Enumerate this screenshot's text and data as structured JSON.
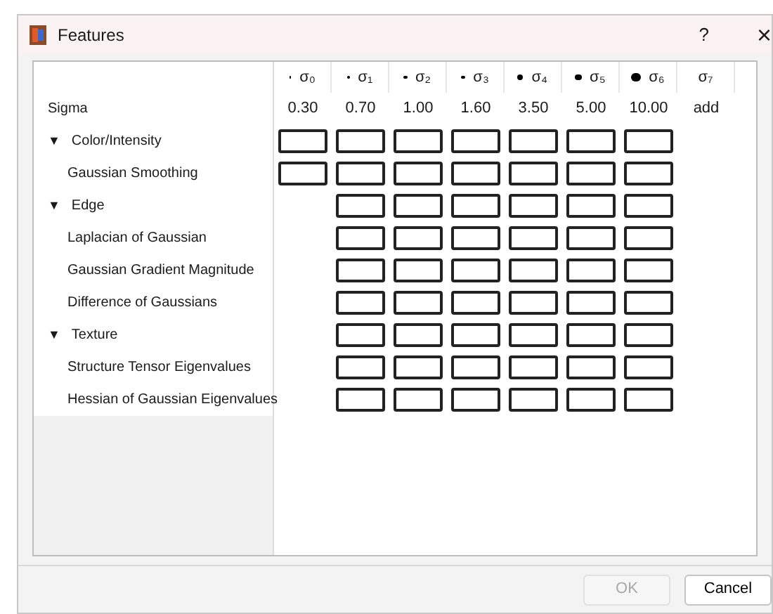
{
  "window": {
    "title": "Features",
    "help": "?",
    "close": "×"
  },
  "columns": [
    {
      "label": "σ₀",
      "marker": true
    },
    {
      "label": "σ₁",
      "marker": true
    },
    {
      "label": "σ₂",
      "marker": true
    },
    {
      "label": "σ₃",
      "marker": true
    },
    {
      "label": "σ₄",
      "marker": true
    },
    {
      "label": "σ₅",
      "marker": true
    },
    {
      "label": "σ₆",
      "marker": true
    },
    {
      "label": "σ₇",
      "marker": false
    }
  ],
  "sigma": {
    "label": "Sigma",
    "values": [
      "0.30",
      "0.70",
      "1.00",
      "1.60",
      "3.50",
      "5.00",
      "10.00",
      "add"
    ]
  },
  "groups": [
    {
      "label": "Color/Intensity",
      "expanded": true,
      "toggle": "▼",
      "cells": [
        {
          "kind": "checkbox",
          "checked": false
        },
        {
          "kind": "checkbox",
          "checked": false
        },
        {
          "kind": "checkbox",
          "checked": false
        },
        {
          "kind": "checkbox",
          "checked": false
        },
        {
          "kind": "checkbox",
          "checked": false
        },
        {
          "kind": "checkbox",
          "checked": false
        },
        {
          "kind": "checkbox",
          "checked": false
        }
      ],
      "children": [
        {
          "label": "Gaussian Smoothing",
          "cells": [
            {
              "kind": "checkbox",
              "checked": false
            },
            {
              "kind": "checkbox",
              "checked": false
            },
            {
              "kind": "checkbox",
              "checked": false
            },
            {
              "kind": "checkbox",
              "checked": false
            },
            {
              "kind": "checkbox",
              "checked": false
            },
            {
              "kind": "checkbox",
              "checked": false
            },
            {
              "kind": "checkbox",
              "checked": false
            }
          ]
        }
      ]
    },
    {
      "label": "Edge",
      "expanded": true,
      "toggle": "▼",
      "cells": [
        {
          "kind": "empty"
        },
        {
          "kind": "checkbox",
          "checked": false
        },
        {
          "kind": "checkbox",
          "checked": false
        },
        {
          "kind": "checkbox",
          "checked": false
        },
        {
          "kind": "checkbox",
          "checked": false
        },
        {
          "kind": "checkbox",
          "checked": false
        },
        {
          "kind": "checkbox",
          "checked": false
        }
      ],
      "children": [
        {
          "label": "Laplacian of Gaussian",
          "cells": [
            {
              "kind": "empty"
            },
            {
              "kind": "checkbox",
              "checked": false
            },
            {
              "kind": "checkbox",
              "checked": false
            },
            {
              "kind": "checkbox",
              "checked": false
            },
            {
              "kind": "checkbox",
              "checked": false
            },
            {
              "kind": "checkbox",
              "checked": false
            },
            {
              "kind": "checkbox",
              "checked": false
            }
          ]
        },
        {
          "label": "Gaussian Gradient Magnitude",
          "cells": [
            {
              "kind": "empty"
            },
            {
              "kind": "checkbox",
              "checked": false
            },
            {
              "kind": "checkbox",
              "checked": false
            },
            {
              "kind": "checkbox",
              "checked": false
            },
            {
              "kind": "checkbox",
              "checked": false
            },
            {
              "kind": "checkbox",
              "checked": false
            },
            {
              "kind": "checkbox",
              "checked": false
            }
          ]
        },
        {
          "label": "Difference of Gaussians",
          "cells": [
            {
              "kind": "empty"
            },
            {
              "kind": "checkbox",
              "checked": false
            },
            {
              "kind": "checkbox",
              "checked": false
            },
            {
              "kind": "checkbox",
              "checked": false
            },
            {
              "kind": "checkbox",
              "checked": false
            },
            {
              "kind": "checkbox",
              "checked": false
            },
            {
              "kind": "checkbox",
              "checked": false
            }
          ]
        }
      ]
    },
    {
      "label": "Texture",
      "expanded": true,
      "toggle": "▼",
      "cells": [
        {
          "kind": "empty"
        },
        {
          "kind": "checkbox",
          "checked": false
        },
        {
          "kind": "checkbox",
          "checked": false
        },
        {
          "kind": "checkbox",
          "checked": false
        },
        {
          "kind": "checkbox",
          "checked": false
        },
        {
          "kind": "checkbox",
          "checked": false
        },
        {
          "kind": "checkbox",
          "checked": false
        }
      ],
      "children": [
        {
          "label": "Structure Tensor Eigenvalues",
          "cells": [
            {
              "kind": "empty"
            },
            {
              "kind": "checkbox",
              "checked": false
            },
            {
              "kind": "checkbox",
              "checked": false
            },
            {
              "kind": "checkbox",
              "checked": false
            },
            {
              "kind": "checkbox",
              "checked": false
            },
            {
              "kind": "checkbox",
              "checked": false
            },
            {
              "kind": "checkbox",
              "checked": false
            }
          ]
        },
        {
          "label": "Hessian of Gaussian Eigenvalues",
          "cells": [
            {
              "kind": "empty"
            },
            {
              "kind": "checkbox",
              "checked": false
            },
            {
              "kind": "checkbox",
              "checked": false
            },
            {
              "kind": "checkbox",
              "checked": false
            },
            {
              "kind": "checkbox",
              "checked": false
            },
            {
              "kind": "checkbox",
              "checked": false
            },
            {
              "kind": "checkbox",
              "checked": false
            }
          ]
        }
      ]
    }
  ],
  "buttons": [
    {
      "label": "OK",
      "disabled": true
    },
    {
      "label": "Cancel",
      "disabled": false
    }
  ]
}
